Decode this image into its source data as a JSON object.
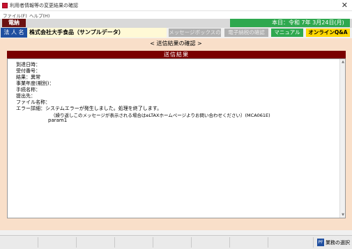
{
  "window": {
    "title": "利用者情報等の変更結果の確認",
    "close_glyph": "✕"
  },
  "menu": {
    "items": [
      "ファイル(F)",
      "ヘルプ(H)"
    ]
  },
  "header": {
    "denno_label": "電納",
    "date_text": "本日：令和 7年 3月24日(月)",
    "corp_label": "法 人 名",
    "corp_name": "株式会社大手食品（サンプルデータ）",
    "buttons": {
      "message_box": "メッセージボックスの確認",
      "e_payment": "電子納税の確認",
      "manual": "マニュアル",
      "online_qa": "オンラインQ&A"
    }
  },
  "main": {
    "title": "< 送信結果の確認 >",
    "result_header": "送信結果",
    "lines": [
      "到達日時：",
      "受付番号：",
      "結果：異常",
      "事業年度(期別)：",
      "手続名称：",
      "提出先：",
      "ファイル名称：",
      "エラー詳細：システムエラーが発生しました。処理を終了します。",
      "（繰り返しこのメッセージが表示される場合はeLTAXホームページよりお問い合わせください）(MCA061E)",
      "param1"
    ]
  },
  "statusbar": {
    "pf_key": "PF",
    "action_label": "業務の選択"
  },
  "colors": {
    "denno_bg": "#6b1212",
    "date_bg": "#2fa84f",
    "corp_label_bg": "#1f4fa0",
    "result_header_bg": "#7a0000",
    "panel_bg": "#f9dfc9",
    "qa_bg": "#ffd700"
  }
}
